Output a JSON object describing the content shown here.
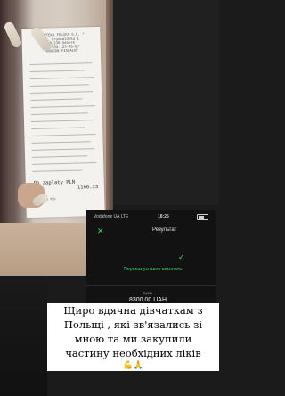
{
  "receipt": {
    "header_lines": [
      "* APTEKA FELIKS S.C. *",
      "ul. Grunwaldzka 1",
      "80-236 Gdansk",
      "NIP 584-123-45-67",
      "",
      "PARAGON FISKALNY"
    ],
    "zaplata_label": "Do zaplaty PLN",
    "total": "1166.33",
    "footer": "Gotowka PLN"
  },
  "phone": {
    "carrier": "Vodafone UA  LTE",
    "time": "18:25",
    "title": "Результат",
    "close_icon": "close-icon",
    "success_icon": "check-icon",
    "success_text": "Переказ успішно виконано",
    "amount_label": "Сума",
    "amount": "8300.00 UAH"
  },
  "caption": {
    "lines": [
      "Щиро вдячна дівчаткам з",
      "Польщі , які зв'язались зі",
      "мною та ми закупили",
      "частину необхідних ліків"
    ],
    "emoji": "💪🙏"
  }
}
